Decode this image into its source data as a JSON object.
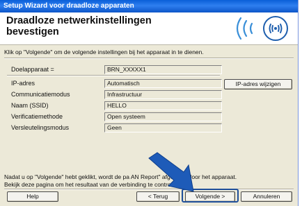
{
  "window": {
    "title": "Setup Wizard voor draadloze apparaten"
  },
  "header": {
    "title": "Draadloze netwerkinstellingen bevestigen"
  },
  "instruction": "Klik op \"Volgende\" om de volgende instellingen bij het apparaat in te dienen.",
  "settings": [
    {
      "label": "Doelapparaat =",
      "value": "BRN_XXXXX1"
    },
    {
      "label": "IP-adres",
      "value": "Automatisch"
    },
    {
      "label": "Communicatiemodus",
      "value": "Infrastructuur"
    },
    {
      "label": "Naam (SSID)",
      "value": "HELLO"
    },
    {
      "label": "Verificatiemethode",
      "value": "Open systeem"
    },
    {
      "label": "Versleutelingsmodus",
      "value": "Geen"
    }
  ],
  "buttons": {
    "change_ip": "IP-adres wijzigen",
    "help": "Help",
    "back": "< Terug",
    "next": "Volgende >",
    "cancel": "Annuleren"
  },
  "footer": {
    "line1": "Nadat u op \"Volgende\" hebt geklikt, wordt de pa          AN Report\" afgedrukt door het apparaat.",
    "line2": "Bekijk deze pagina om het resultaat van de verbinding te controleren."
  },
  "colors": {
    "titlebar": "#0a5fd8",
    "dialog_bg": "#ece9d8",
    "arrow": "#1e5bb8",
    "highlight": "#1f4f9a"
  },
  "icons": {
    "header_graphic": "wireless-signal-icon",
    "pointer": "arrow-pointer-icon"
  }
}
